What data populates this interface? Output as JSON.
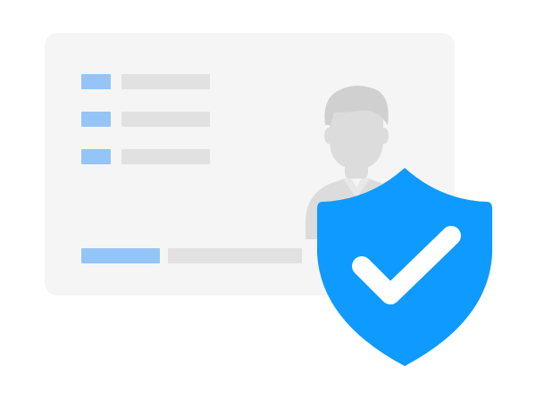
{
  "illustration": {
    "card_color": "#f5f5f5",
    "placeholder_bar_color": "#94c5f6",
    "placeholder_line_color": "#e1e1e1",
    "avatar_color": "#dcdcdc",
    "shield_color": "#0e9aff",
    "checkmark_color": "#ffffff",
    "icons": [
      "user-avatar-icon",
      "shield-icon",
      "checkmark-icon"
    ]
  }
}
